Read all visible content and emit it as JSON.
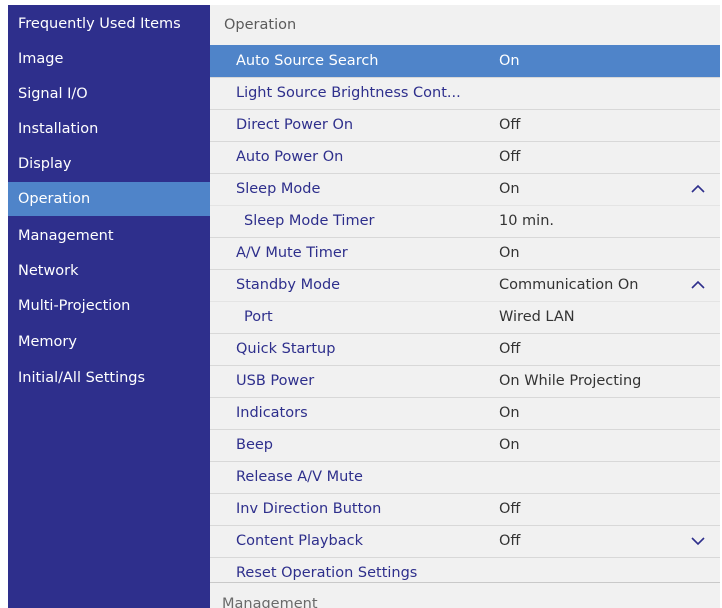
{
  "sidebar": {
    "items": [
      {
        "label": "Frequently Used Items"
      },
      {
        "label": "Image"
      },
      {
        "label": "Signal I/O"
      },
      {
        "label": "Installation"
      },
      {
        "label": "Display"
      },
      {
        "label": "Operation"
      },
      {
        "label": "Management"
      },
      {
        "label": "Network"
      },
      {
        "label": "Multi-Projection"
      },
      {
        "label": "Memory"
      },
      {
        "label": "Initial/All Settings"
      }
    ],
    "selected": "Operation"
  },
  "main": {
    "header": "Operation",
    "rows": [
      {
        "label": "Auto Source Search",
        "value": "On"
      },
      {
        "label": "Light Source Brightness Cont...",
        "value": ""
      },
      {
        "label": "Direct Power On",
        "value": "Off"
      },
      {
        "label": "Auto Power On",
        "value": "Off"
      },
      {
        "label": "Sleep Mode",
        "value": "On",
        "icon": "chevron-up-icon"
      },
      {
        "label": "Sleep Mode Timer",
        "value": "10 min."
      },
      {
        "label": "A/V Mute Timer",
        "value": "On"
      },
      {
        "label": "Standby Mode",
        "value": "Communication On",
        "icon": "chevron-up-icon"
      },
      {
        "label": "Port",
        "value": "Wired LAN"
      },
      {
        "label": "Quick Startup",
        "value": "Off"
      },
      {
        "label": "USB Power",
        "value": "On While Projecting"
      },
      {
        "label": "Indicators",
        "value": "On"
      },
      {
        "label": "Beep",
        "value": "On"
      },
      {
        "label": "Release A/V Mute",
        "value": ""
      },
      {
        "label": "Inv Direction Button",
        "value": "Off"
      },
      {
        "label": "Content Playback",
        "value": "Off",
        "icon": "chevron-down-icon"
      },
      {
        "label": "Reset Operation Settings",
        "value": ""
      }
    ],
    "next_section": "Management"
  },
  "colors": {
    "sidebar_bg": "#2e2f8c",
    "highlight": "#4f84c9",
    "panel_bg": "#f1f1f1",
    "label_text": "#2e2f8c"
  }
}
